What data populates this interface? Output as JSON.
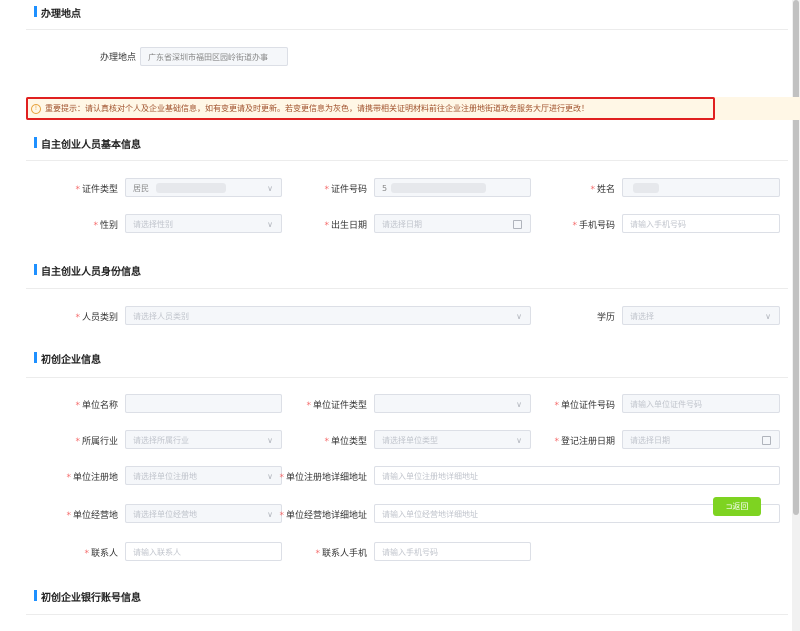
{
  "sections": {
    "location": "办理地点",
    "basic": "自主创业人员基本信息",
    "identity": "自主创业人员身份信息",
    "company": "初创企业信息",
    "bank": "初创企业银行账号信息"
  },
  "location": {
    "label": "办理地点",
    "value": "广东省深圳市福田区园岭街道办事"
  },
  "notice": "重要提示：请认真核对个人及企业基础信息，如有变更请及时更新。若变更信息为灰色，请携带相关证明材料前往企业注册地街道政务服务大厅进行更改！",
  "basic": {
    "id_type_label": "证件类型",
    "id_type_value": "居民",
    "id_no_label": "证件号码",
    "id_no_value": "5",
    "name_label": "姓名",
    "gender_label": "性别",
    "gender_placeholder": "请选择性别",
    "birth_label": "出生日期",
    "birth_placeholder": "请选择日期",
    "phone_label": "手机号码",
    "phone_placeholder": "请输入手机号码"
  },
  "identity": {
    "category_label": "人员类别",
    "category_placeholder": "请选择人员类别",
    "edu_label": "学历",
    "edu_placeholder": "请选择"
  },
  "company": {
    "name_label": "单位名称",
    "cert_type_label": "单位证件类型",
    "cert_no_label": "单位证件号码",
    "cert_no_placeholder": "请输入单位证件号码",
    "industry_label": "所属行业",
    "industry_placeholder": "请选择所属行业",
    "type_label": "单位类型",
    "type_placeholder": "请选择单位类型",
    "reg_date_label": "登记注册日期",
    "reg_date_placeholder": "请选择日期",
    "reg_place_label": "单位注册地",
    "reg_place_placeholder": "请选择单位注册地",
    "reg_addr_label": "单位注册地详细地址",
    "reg_addr_placeholder": "请输入单位注册地详细地址",
    "op_place_label": "单位经营地",
    "op_place_placeholder": "请选择单位经营地",
    "op_addr_label": "单位经营地详细地址",
    "op_addr_placeholder": "请输入单位经营地详细地址",
    "contact_label": "联系人",
    "contact_placeholder": "请输入联系人",
    "contact_phone_label": "联系人手机",
    "contact_phone_placeholder": "请输入手机号码"
  },
  "back_button": "返回"
}
